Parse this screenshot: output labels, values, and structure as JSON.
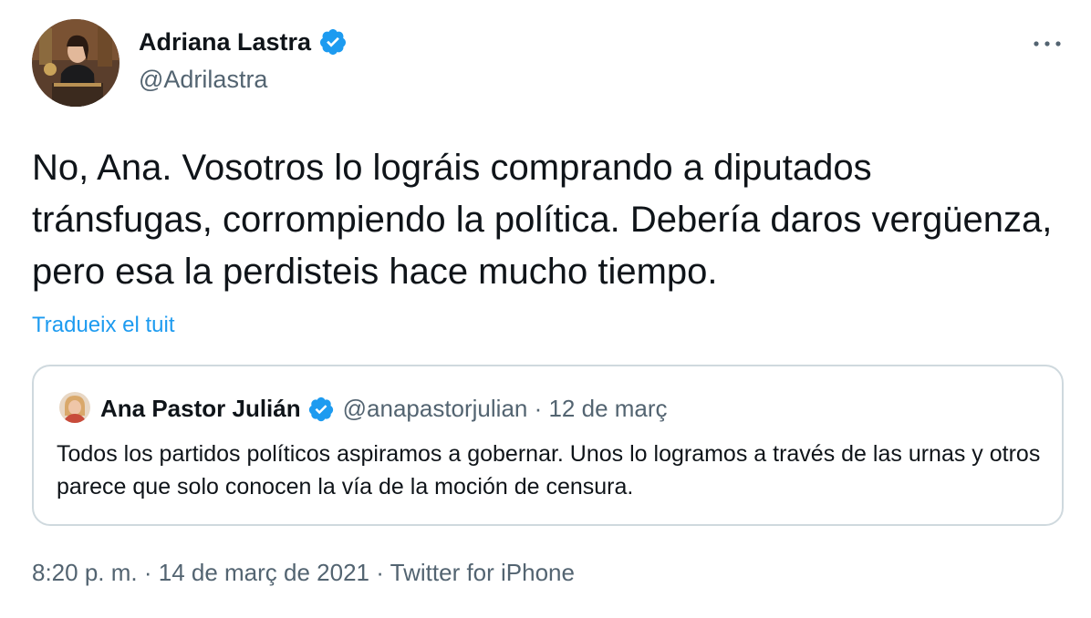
{
  "author": {
    "name": "Adriana Lastra",
    "handle": "@Adrilastra",
    "verified_icon": "verified-badge-icon"
  },
  "tweet": {
    "text": "No, Ana. Vosotros lo lográis comprando a diputados tránsfugas, corrompiendo la política. Debería daros vergüenza, pero esa la perdisteis hace mucho tiempo.",
    "translate_label": "Tradueix el tuit"
  },
  "quoted": {
    "name": "Ana Pastor Julián",
    "handle_date": "@anapastorjulian · 12 de març",
    "text": "Todos los partidos políticos aspiramos a gobernar. Unos lo logramos a través de las urnas y otros parece que solo conocen la vía de la moción de censura."
  },
  "meta": {
    "time": "8:20 p. m.",
    "sep1": " · ",
    "date": "14 de març de 2021",
    "sep2": " · ",
    "source": "Twitter for iPhone"
  },
  "colors": {
    "accent": "#1d9bf0",
    "text": "#0f1419",
    "secondary": "#536471",
    "border": "#cfd9de"
  }
}
